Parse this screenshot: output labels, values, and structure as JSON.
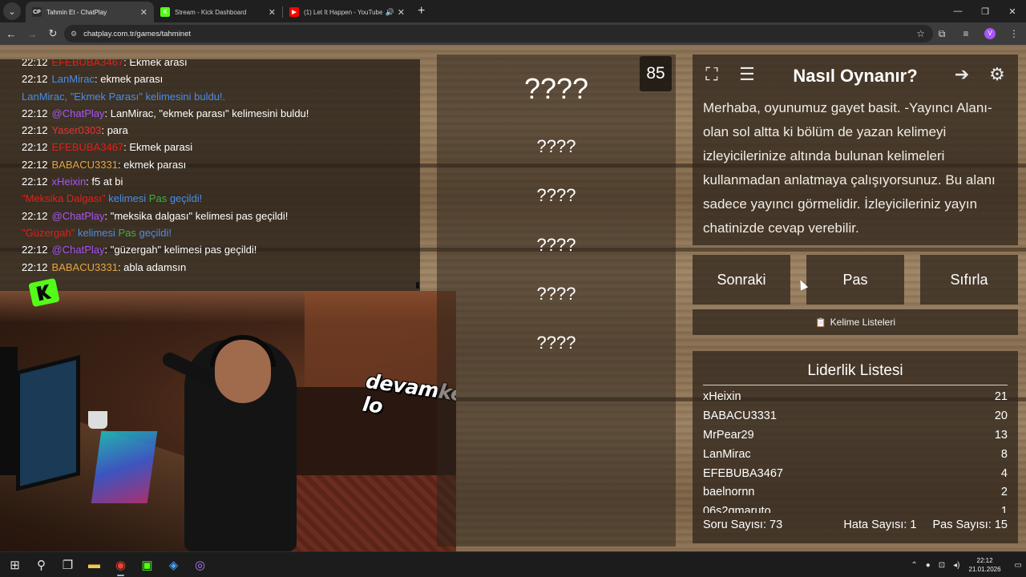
{
  "browser": {
    "tabs": [
      {
        "title": "Tahmin Et - ChatPlay",
        "active": true,
        "favicon_color": "#2b2b2b",
        "favicon_text": "CP"
      },
      {
        "title": "Stream - Kick Dashboard",
        "active": false,
        "favicon_color": "#53fc18",
        "favicon_text": "K"
      },
      {
        "title": "(1) Let It Happen - YouTube",
        "active": false,
        "favicon_color": "#ff0000",
        "favicon_text": "▶"
      }
    ],
    "url": "chatplay.com.tr/games/tahminet",
    "profile_initial": "V"
  },
  "chat": {
    "lines": [
      {
        "time": "22:12",
        "user": "EFEBUBA3467",
        "user_color": "#e0201a",
        "text": ": Ekmek arası"
      },
      {
        "time": "22:12",
        "user": "LanMirac",
        "user_color": "#4a8de8",
        "text": ": ekmek parası"
      },
      {
        "time": "",
        "user": "LanMirac, \"Ekmek Parası\" kelimesini buldu!.",
        "user_color": "#4a8de8",
        "text": ""
      },
      {
        "time": "22:12",
        "user": "@ChatPlay",
        "user_color": "#a855f7",
        "text": ": LanMirac, \"ekmek parası\" kelimesini buldu!"
      },
      {
        "time": "22:12",
        "user": "Yaser0303",
        "user_color": "#e63232",
        "text": ": para"
      },
      {
        "time": "22:12",
        "user": "EFEBUBA3467",
        "user_color": "#e0201a",
        "text": ": Ekmek parasi"
      },
      {
        "time": "22:12",
        "user": "BABACU3331",
        "user_color": "#e5a540",
        "text": ": ekmek parası"
      },
      {
        "time": "22:12",
        "user": "xHeixin",
        "user_color": "#a855f7",
        "text": ": f5 at bi"
      },
      {
        "time": "",
        "user": "\"Meksika Dalgası\"",
        "user_color": "#e0201a",
        "text": " kelimesi Pas geçildi!",
        "special": "pass"
      },
      {
        "time": "22:12",
        "user": "@ChatPlay",
        "user_color": "#a855f7",
        "text": ": \"meksika dalgası\" kelimesi pas geçildi!"
      },
      {
        "time": "",
        "user": "\"Güzergah\"",
        "user_color": "#e0201a",
        "text": " kelimesi Pas geçildi!",
        "special": "pass"
      },
      {
        "time": "22:12",
        "user": "@ChatPlay",
        "user_color": "#a855f7",
        "text": ": \"güzergah\" kelimesi pas geçildi!"
      },
      {
        "time": "22:12",
        "user": "BABACU3331",
        "user_color": "#e5a540",
        "text": ": abla adamsın"
      }
    ]
  },
  "webcam": {
    "caption": "devamke lo"
  },
  "game": {
    "timer": "85",
    "word_slots": [
      "????",
      "????",
      "????",
      "????",
      "????",
      "????"
    ]
  },
  "how_to_play": {
    "title": "Nasıl Oynanır?",
    "text": "Merhaba, oyunumuz gayet basit. -Yayıncı Alanı- olan sol altta ki bölüm de yazan kelimeyi izleyicilerinize altında bulunan kelimeleri kullanmadan anlatmaya çalışıyorsunuz. Bu alanı sadece yayıncı görmelidir. İzleyicileriniz yayın chatinizde cevap verebilir.",
    "icons": [
      "expand-icon",
      "list-icon",
      "exit-icon",
      "gear-icon"
    ]
  },
  "buttons": {
    "next": "Sonraki",
    "pass": "Pas",
    "reset": "Sıfırla",
    "word_lists": "Kelime Listeleri"
  },
  "leaderboard": {
    "title": "Liderlik Listesi",
    "rows": [
      {
        "name": "xHeixin",
        "score": "21"
      },
      {
        "name": "BABACU3331",
        "score": "20"
      },
      {
        "name": "MrPear29",
        "score": "13"
      },
      {
        "name": "LanMirac",
        "score": "8"
      },
      {
        "name": "EFEBUBA3467",
        "score": "4"
      },
      {
        "name": "baelnornn",
        "score": "2"
      },
      {
        "name": "06s2gmaruto",
        "score": "1"
      }
    ],
    "question_count": "Soru Sayısı: 73",
    "error_count": "Hata Sayısı: 1",
    "pass_count": "Pas Sayısı: 15"
  },
  "taskbar": {
    "time": "22:12",
    "date": "21.01.2026"
  }
}
